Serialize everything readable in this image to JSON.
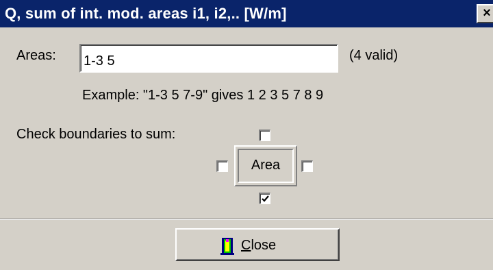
{
  "window": {
    "title": "Q, sum of int. mod. areas i1, i2,.. [W/m]",
    "close_glyph": "×"
  },
  "areas": {
    "label": "Areas:",
    "value": "1-3 5",
    "valid_count": "(4 valid)",
    "example": "Example: \"1-3 5 7-9\" gives 1 2 3 5 7 8 9"
  },
  "boundaries": {
    "label": "Check boundaries to sum:",
    "center_label": "Area",
    "top_checked": false,
    "left_checked": false,
    "right_checked": false,
    "bottom_checked": true
  },
  "footer": {
    "close_icon": "door-exit-icon",
    "close_mnemonic": "C",
    "close_rest": "lose"
  }
}
